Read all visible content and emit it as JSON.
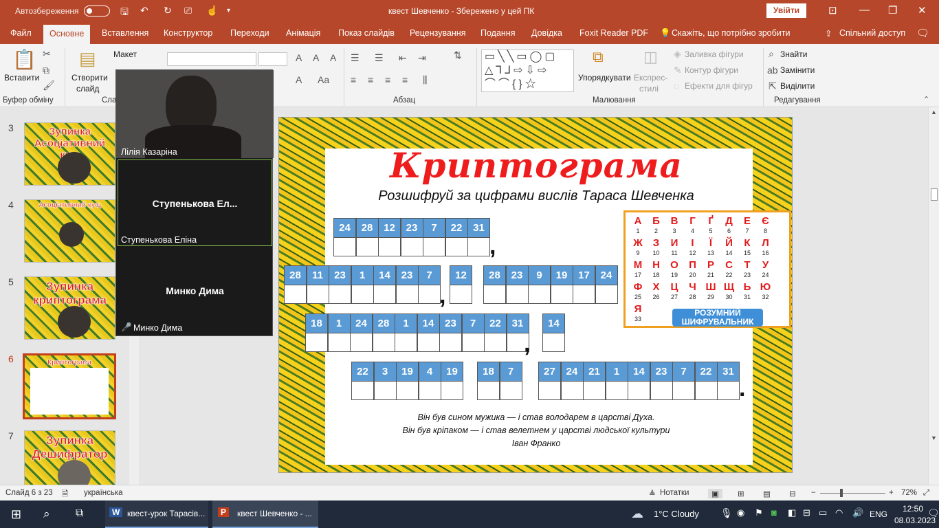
{
  "titlebar": {
    "autosave": "Автозбереження",
    "title": "квест Шевченко  -  Збережено у цей ПК",
    "login": "Увійти"
  },
  "tabs": [
    "Файл",
    "Основне",
    "Вставлення",
    "Конструктор",
    "Переходи",
    "Анімація",
    "Показ слайдів",
    "Рецензування",
    "Подання",
    "Довідка",
    "Foxit Reader PDF"
  ],
  "tell_me": "Скажіть, що потрібно зробити",
  "share": "Спільний доступ",
  "ribbon": {
    "paste": "Вставити",
    "clipboard": "Буфер обміну",
    "new_slide": "Створити",
    "new_slide2": "слайд",
    "layout": "Макет",
    "slides_group": "Сла",
    "paragraph": "Абзац",
    "drawing": "Малювання",
    "arrange": "Упорядкувати",
    "styles": "Експрес-",
    "styles2": "стилі",
    "fill": "Заливка фігури",
    "outline": "Контур фігури",
    "effects": "Ефекти для фігур",
    "find": "Знайти",
    "replace": "Замінити",
    "select": "Виділити",
    "editing": "Редагування"
  },
  "thumbs": [
    {
      "num": "3",
      "title": "Зупинка Асоціативний кущ"
    },
    {
      "num": "4",
      "title": "Асоціативний кущ"
    },
    {
      "num": "5",
      "title": "Зупинка криптограма"
    },
    {
      "num": "6",
      "title": "Криптограма"
    },
    {
      "num": "7",
      "title": "Зупинка Дешифратор"
    }
  ],
  "zoom": {
    "p1": "Лілія Казаріна",
    "p2_big": "Ступенькова  Ел...",
    "p2": "Ступенькова Еліна",
    "p3_big": "Минко Дима",
    "p3": "Минко Дима"
  },
  "slide": {
    "title": "Криптограма",
    "subtitle": "Розшифруй за цифрами вислів Тараса Шевченка",
    "row1": [
      "24",
      "28",
      "12",
      "23",
      "7",
      "22",
      "31"
    ],
    "row2a": [
      "28",
      "11",
      "23",
      "1",
      "14",
      "23",
      "7"
    ],
    "row2b": [
      "12"
    ],
    "row2c": [
      "28",
      "23",
      "9",
      "19",
      "17",
      "24"
    ],
    "row3a": [
      "18",
      "1",
      "24",
      "28",
      "1",
      "14",
      "23",
      "7",
      "22",
      "31"
    ],
    "row3b": [
      "14"
    ],
    "row4a": [
      "22",
      "3",
      "19",
      "4",
      "19"
    ],
    "row4b": [
      "18",
      "7"
    ],
    "row4c": [
      "27",
      "24",
      "21",
      "1",
      "14",
      "23",
      "7",
      "22",
      "31"
    ],
    "comma": ",",
    "period": ".",
    "cipher_letters": [
      "А",
      "Б",
      "В",
      "Г",
      "Ґ",
      "Д",
      "Е",
      "Є",
      "Ж",
      "З",
      "И",
      "І",
      "Ї",
      "Й",
      "К",
      "Л",
      "М",
      "Н",
      "О",
      "П",
      "Р",
      "С",
      "Т",
      "У",
      "Ф",
      "Х",
      "Ц",
      "Ч",
      "Ш",
      "Щ",
      "Ь",
      "Ю",
      "Я"
    ],
    "cipher_label": "РОЗУМНИЙ ШИФРУВАЛЬНИК",
    "quote1": "Він був сином мужика — і став володарем в царстві Духа.",
    "quote2": "Він був кріпаком — і став велетнем у царстві людської культури",
    "quote3": "Іван Франко"
  },
  "status": {
    "slide": "Слайд 6 з 23",
    "lang": "українська",
    "notes": "Нотатки",
    "zoom": "72%"
  },
  "taskbar": {
    "app1": "квест-урок Тарасів...",
    "app2": "квест Шевченко - ...",
    "weather": "1°C  Cloudy",
    "lang": "ENG",
    "time": "12:50",
    "date": "08.03.2023"
  }
}
